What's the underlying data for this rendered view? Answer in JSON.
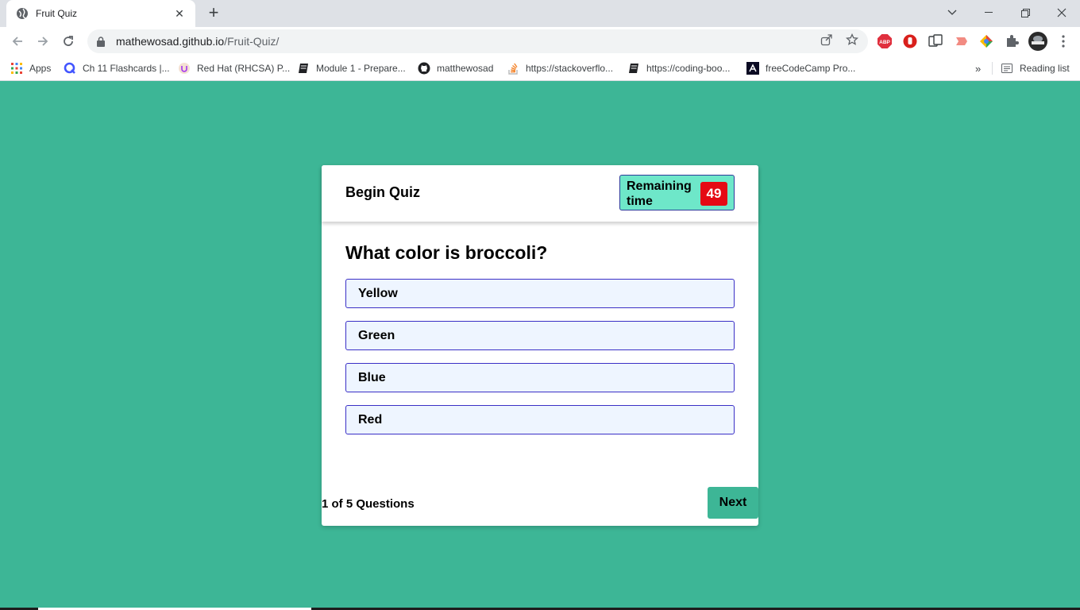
{
  "browser": {
    "tab_title": "Fruit Quiz",
    "url_host": "mathewosad.github.io",
    "url_path": "/Fruit-Quiz/",
    "bookmarks": [
      {
        "label": "Apps",
        "icon": "apps-grid-icon"
      },
      {
        "label": "Ch 11 Flashcards |...",
        "icon": "quizlet-icon"
      },
      {
        "label": "Red Hat (RHCSA) P...",
        "icon": "udemy-icon"
      },
      {
        "label": "Module 1 - Prepare...",
        "icon": "book-icon"
      },
      {
        "label": "matthewosad",
        "icon": "github-icon"
      },
      {
        "label": "https://stackoverflo...",
        "icon": "stackoverflow-icon"
      },
      {
        "label": "https://coding-boo...",
        "icon": "book-icon"
      },
      {
        "label": "freeCodeCamp Pro...",
        "icon": "freecodecamp-icon"
      }
    ],
    "reading_list": "Reading list",
    "extensions": [
      "abp-icon",
      "stop-icon",
      "translate-icon",
      "cast-icon",
      "chrome-color-icon",
      "puzzle-icon",
      "profile-avatar-icon"
    ]
  },
  "quiz": {
    "header_title": "Begin Quiz",
    "timer_label": "Remaining time",
    "timer_value": "49",
    "question": "What color is broccoli?",
    "options": [
      "Yellow",
      "Green",
      "Blue",
      "Red"
    ],
    "progress_text": "1 of 5 Questions",
    "next_label": "Next"
  },
  "colors": {
    "page_bg": "#3db696",
    "timer_bg": "#6ee7c9",
    "timer_badge": "#e50914",
    "option_border": "#3a2fc6",
    "option_bg": "#eef5ff"
  }
}
